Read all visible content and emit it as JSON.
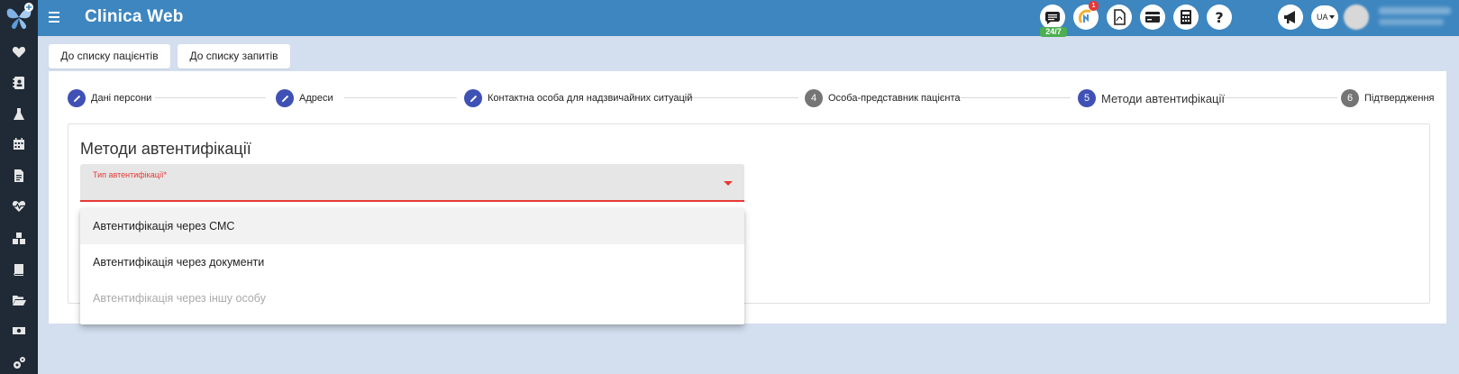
{
  "header": {
    "app_title": "Clinica Web",
    "chat_badge": "24/7",
    "notification_count": "1",
    "language": "UA",
    "user_name": "",
    "user_sub": ""
  },
  "sidebar": {
    "items": [
      {
        "icon": "heart-icon"
      },
      {
        "icon": "patient-card-icon"
      },
      {
        "icon": "flask-icon"
      },
      {
        "icon": "calendar-icon"
      },
      {
        "icon": "document-icon"
      },
      {
        "icon": "heartbeat-icon"
      },
      {
        "icon": "cubes-icon"
      },
      {
        "icon": "book-icon"
      },
      {
        "icon": "folder-open-icon"
      },
      {
        "icon": "money-icon"
      },
      {
        "icon": "cogs-icon"
      }
    ]
  },
  "toolbar": {
    "to_patients_list": "До списку пацієнтів",
    "to_requests_list": "До списку запитів"
  },
  "stepper": {
    "steps": [
      {
        "number": "1",
        "label": "Дані персони",
        "state": "done"
      },
      {
        "number": "2",
        "label": "Адреси",
        "state": "done"
      },
      {
        "number": "3",
        "label": "Контактна особа для надзвичайних ситуацій",
        "state": "done"
      },
      {
        "number": "4",
        "label": "Особа-представник пацієнта",
        "state": "todo"
      },
      {
        "number": "5",
        "label": "Методи автентифікації",
        "state": "active"
      },
      {
        "number": "6",
        "label": "Підтвердження",
        "state": "todo"
      }
    ]
  },
  "form": {
    "section_title": "Методи автентифікації",
    "auth_type_label": "Тип автентифікації*",
    "auth_type_value": "",
    "options": [
      {
        "label": "Автентифікація через СМС",
        "state": "highlighted"
      },
      {
        "label": "Автентифікація через документи",
        "state": "normal"
      },
      {
        "label": "Автентифікація через іншу особу",
        "state": "disabled"
      }
    ]
  },
  "colors": {
    "topbar": "#3d86c0",
    "sidebar": "#1f2a36",
    "background": "#d3deee",
    "step_active": "#3f51b5",
    "step_todo": "#757575",
    "error": "#e53935",
    "badge_green": "#4caf50"
  },
  "top_icons": [
    "chat-icon",
    "analytics-icon",
    "pdf-icon",
    "credit-card-icon",
    "calculator-icon",
    "help-icon",
    "megaphone-icon"
  ]
}
